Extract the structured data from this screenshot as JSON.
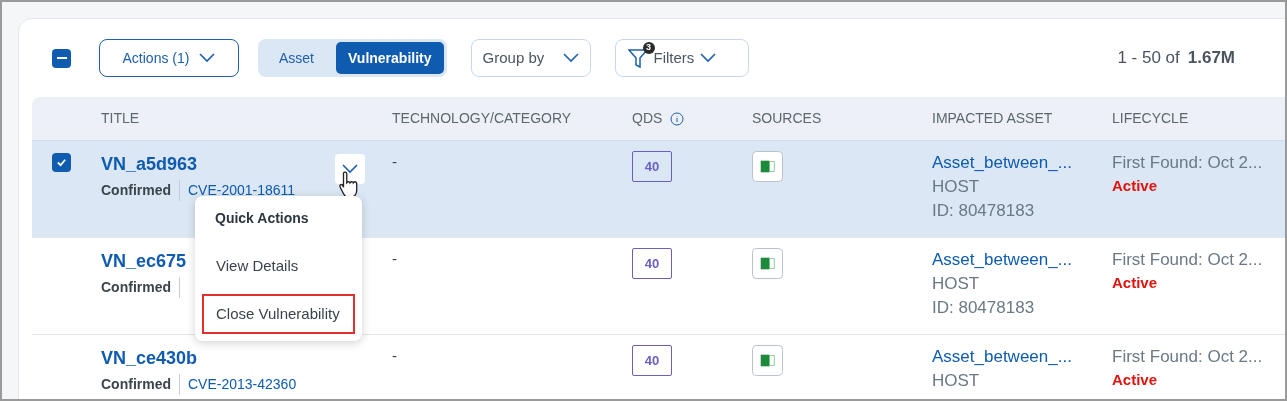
{
  "toolbar": {
    "select_all": {
      "indeterminate": true
    },
    "actions": {
      "label": "Actions (1)"
    },
    "view_toggle": [
      {
        "label": "Asset",
        "selected": false
      },
      {
        "label": "Vulnerability",
        "selected": true
      }
    ],
    "group_by": {
      "label": "Group by"
    },
    "filters": {
      "label": "Filters",
      "badge": "3"
    },
    "pagination": {
      "range": "1 - 50 of",
      "total": "1.67M"
    }
  },
  "table": {
    "columns": [
      "TITLE",
      "TECHNOLOGY/CATEGORY",
      "QDS",
      "SOURCES",
      "IMPACTED ASSET",
      "LIFECYCLE"
    ],
    "rows": [
      {
        "selected": true,
        "title": "VN_a5d963",
        "status": "Confirmed",
        "cve": "CVE-2001-18611",
        "technology": "-",
        "qds": "40",
        "asset": "Asset_between_...",
        "asset_type": "HOST",
        "asset_id": "ID: 80478183",
        "first_found": "First Found: Oct 2...",
        "lifecycle": "Active"
      },
      {
        "selected": false,
        "title": "VN_ec675",
        "status": "Confirmed",
        "technology": "-",
        "qds": "40",
        "asset": "Asset_between_...",
        "asset_type": "HOST",
        "asset_id": "ID: 80478183",
        "first_found": "First Found: Oct 2...",
        "lifecycle": "Active"
      },
      {
        "selected": false,
        "title": "VN_ce430b",
        "status": "Confirmed",
        "cve": "CVE-2013-42360",
        "technology": "-",
        "qds": "40",
        "asset": "Asset_between_...",
        "asset_type": "HOST",
        "first_found": "First Found: Oct 2...",
        "lifecycle": "Active"
      }
    ]
  },
  "quick_actions": {
    "title": "Quick Actions",
    "items": [
      {
        "label": "View Details",
        "highlighted": false
      },
      {
        "label": "Close Vulnerability",
        "highlighted": true
      }
    ]
  }
}
